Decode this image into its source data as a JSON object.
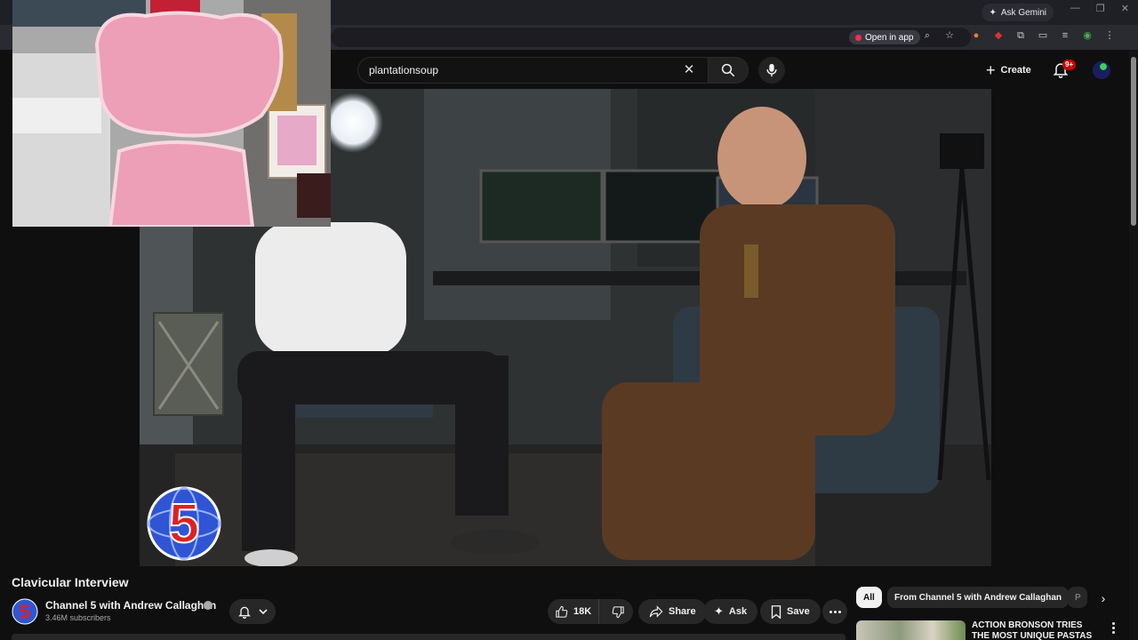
{
  "browser": {
    "ask_gemini": "Ask Gemini",
    "open_in_app": "Open in app"
  },
  "masthead": {
    "search": {
      "value": "plantationsoup"
    },
    "create_label": "Create",
    "notification_badge": "9+"
  },
  "video": {
    "title": "Clavicular Interview",
    "channel": {
      "name": "Channel 5 with Andrew Callaghan",
      "subscribers": "3.46M subscribers",
      "logo_text": "5"
    },
    "actions": {
      "likes": "18K",
      "share": "Share",
      "ask": "Ask",
      "save": "Save"
    }
  },
  "sidebar": {
    "chips": [
      "All",
      "From Channel 5 with Andrew Callaghan",
      "P"
    ],
    "recommendation": {
      "title": "ACTION BRONSON TRIES THE MOST UNIQUE PASTAS"
    }
  },
  "colors": {
    "background": "#0f0f0f",
    "surface": "#272727",
    "text": "#f1f1f1",
    "secondary_text": "#aaaaaa",
    "accent_red": "#cc0000"
  }
}
